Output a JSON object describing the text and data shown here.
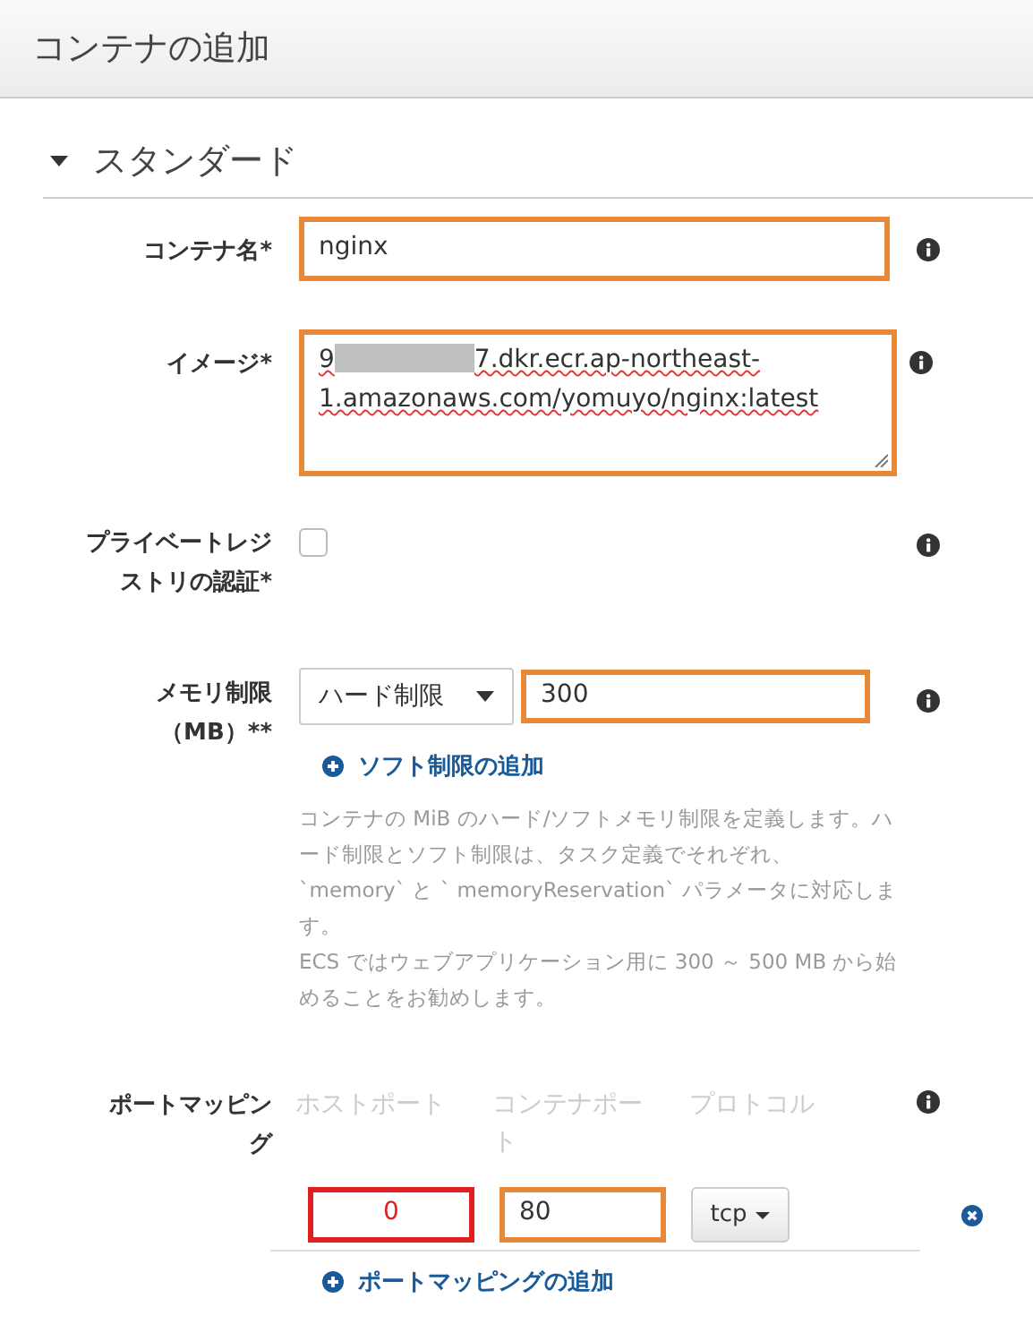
{
  "header": {
    "title": "コンテナの追加"
  },
  "section": {
    "title": "スタンダード",
    "expanded": true
  },
  "container_name": {
    "label": "コンテナ名*",
    "value": "nginx",
    "color": "#e8893a"
  },
  "image": {
    "label": "イメージ*",
    "value_start": "9",
    "value_end": "7.dkr.ecr.ap-northeast-1.amazonaws.com/yomuyo/nginx:latest",
    "color": "#e8893a"
  },
  "private_registry": {
    "label": "プライベートレジストリの認証*",
    "checked": false
  },
  "memory": {
    "label_line1": "メモリ制限",
    "label_line2": "（MB）**",
    "select": "ハード制限",
    "value": "300",
    "color": "#e8893a",
    "add_link": "ソフト制限の追加",
    "help": [
      "コンテナの MiB のハード/ソフトメモリ制限を定義します。ハード制限とソフト制限は、タスク定義でそれぞれ、`memory` と ` memoryReservation` パラメータに対応します。",
      "ECS ではウェブアプリケーション用に 300 ～ 500 MB から始めることをお勧めします。"
    ]
  },
  "port_mapping": {
    "label": "ポートマッピング",
    "columns": [
      "ホストポート",
      "コンテナポート",
      "プロトコル"
    ],
    "rows": [
      {
        "host_port": {
          "value": "0",
          "color": "#e02020"
        },
        "container_port": {
          "value": "80",
          "color": "#e8893a"
        },
        "protocol": "tcp"
      }
    ],
    "add_link": "ポートマッピングの追加"
  }
}
